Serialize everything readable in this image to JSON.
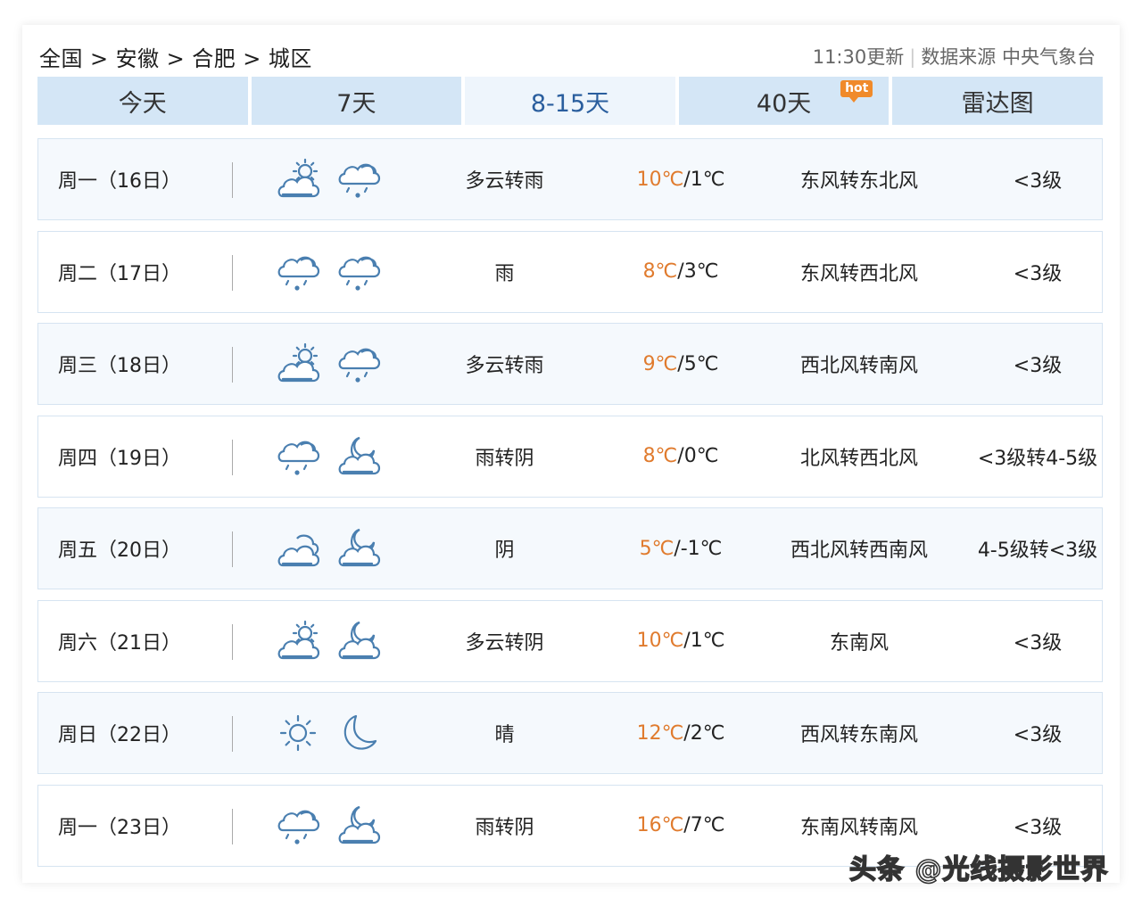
{
  "breadcrumb": [
    "全国",
    "安徽",
    "合肥",
    "城区"
  ],
  "breadcrumb_separator": ">",
  "meta": {
    "updated": "11:30更新",
    "divider": "|",
    "source": "数据来源 中央气象台"
  },
  "tabs": [
    {
      "label": "今天",
      "active": false
    },
    {
      "label": "7天",
      "active": false
    },
    {
      "label": "8-15天",
      "active": true
    },
    {
      "label": "40天",
      "active": false,
      "badge": "hot"
    },
    {
      "label": "雷达图",
      "active": false
    }
  ],
  "forecast": [
    {
      "date": "周一（16日）",
      "icons": [
        "partly-cloudy-day-icon",
        "rain-icon"
      ],
      "desc": "多云转雨",
      "high": "10℃",
      "sep": "/",
      "low": "1℃",
      "wind": "东风转东北风",
      "level": "<3级"
    },
    {
      "date": "周二（17日）",
      "icons": [
        "rain-icon",
        "rain-icon"
      ],
      "desc": "雨",
      "high": "8℃",
      "sep": "/",
      "low": "3℃",
      "wind": "东风转西北风",
      "level": "<3级"
    },
    {
      "date": "周三（18日）",
      "icons": [
        "partly-cloudy-day-icon",
        "rain-icon"
      ],
      "desc": "多云转雨",
      "high": "9℃",
      "sep": "/",
      "low": "5℃",
      "wind": "西北风转南风",
      "level": "<3级"
    },
    {
      "date": "周四（19日）",
      "icons": [
        "rain-icon",
        "cloudy-night-icon"
      ],
      "desc": "雨转阴",
      "high": "8℃",
      "sep": "/",
      "low": "0℃",
      "wind": "北风转西北风",
      "level": "<3级转4-5级"
    },
    {
      "date": "周五（20日）",
      "icons": [
        "overcast-icon",
        "cloudy-night-icon"
      ],
      "desc": "阴",
      "high": "5℃",
      "sep": "/",
      "low": "-1℃",
      "wind": "西北风转西南风",
      "level": "4-5级转<3级"
    },
    {
      "date": "周六（21日）",
      "icons": [
        "partly-cloudy-day-icon",
        "cloudy-night-icon"
      ],
      "desc": "多云转阴",
      "high": "10℃",
      "sep": "/",
      "low": "1℃",
      "wind": "东南风",
      "level": "<3级"
    },
    {
      "date": "周日（22日）",
      "icons": [
        "sun-icon",
        "moon-icon"
      ],
      "desc": "晴",
      "high": "12℃",
      "sep": "/",
      "low": "2℃",
      "wind": "西风转东南风",
      "level": "<3级"
    },
    {
      "date": "周一（23日）",
      "icons": [
        "rain-icon",
        "cloudy-night-icon"
      ],
      "desc": "雨转阴",
      "high": "16℃",
      "sep": "/",
      "low": "7℃",
      "wind": "东南风转南风",
      "level": "<3级"
    }
  ],
  "watermark": "头条 @光线摄影世界",
  "colors": {
    "tab_bg": "#d4e6f6",
    "tab_active_bg": "#eef5fc",
    "tab_active_text": "#2a5e9e",
    "temp_high": "#e07b2e",
    "icon_stroke": "#4a7fb0",
    "hot_badge": "#f08a2a"
  }
}
